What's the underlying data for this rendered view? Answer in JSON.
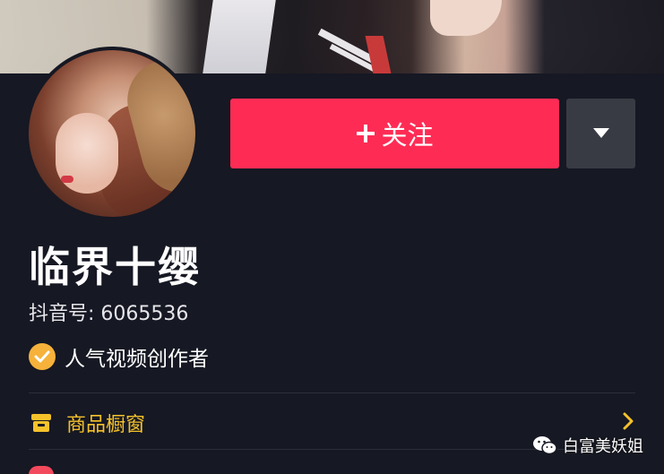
{
  "profile": {
    "follow_label": "关注",
    "nickname": "临界十缨",
    "douyin_id": "抖音号: 6065536",
    "badge_text": "人气视频创作者"
  },
  "shop": {
    "label": "商品橱窗"
  },
  "watermark": {
    "text": "白富美妖姐"
  },
  "icons": {
    "follow": "plus-icon",
    "more": "caret-down-icon",
    "badge": "check-badge-icon",
    "shop": "storefront-icon",
    "chevron": "chevron-right-icon",
    "watermark": "wechat-icon"
  },
  "colors": {
    "background": "#161823",
    "follow_button": "#fe2c55",
    "more_button": "#393b44",
    "shop_label": "#f5c22b",
    "badge": "#f6b23a"
  }
}
